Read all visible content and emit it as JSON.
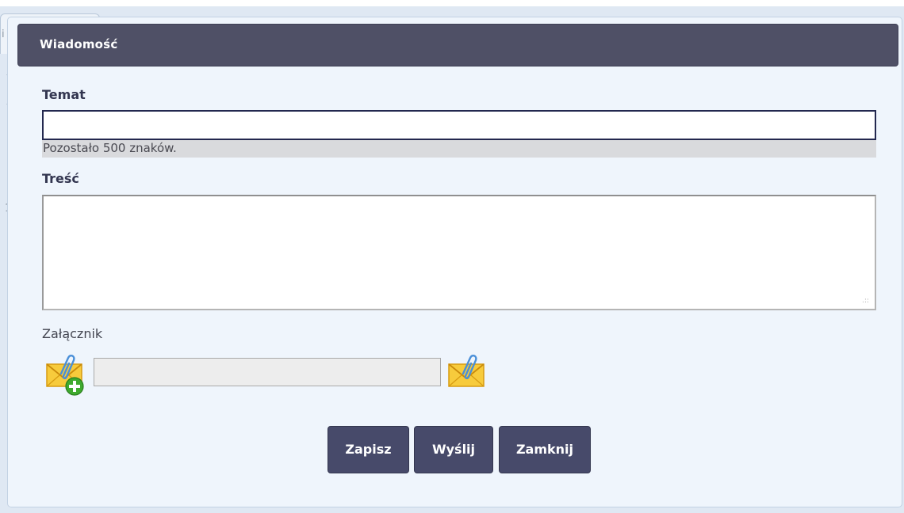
{
  "dialog": {
    "title": "Wiadomość"
  },
  "subject": {
    "label": "Temat",
    "value": "",
    "counter_text": "Pozostało 500 znaków."
  },
  "body": {
    "label": "Treść",
    "value": ""
  },
  "attachment": {
    "label": "Załącznik",
    "file_value": "",
    "add_icon": "envelope-paperclip-add-icon",
    "attach_icon": "envelope-paperclip-icon"
  },
  "actions": {
    "save_label": "Zapisz",
    "send_label": "Wyślij",
    "close_label": "Zamknij"
  },
  "background": {
    "fragment_text_1": "i",
    "fragment_text_2": "1"
  },
  "colors": {
    "titlebar": "#4f5066",
    "button": "#474a6a",
    "dialog_background": "#eff5fc",
    "label_text": "#333650"
  }
}
